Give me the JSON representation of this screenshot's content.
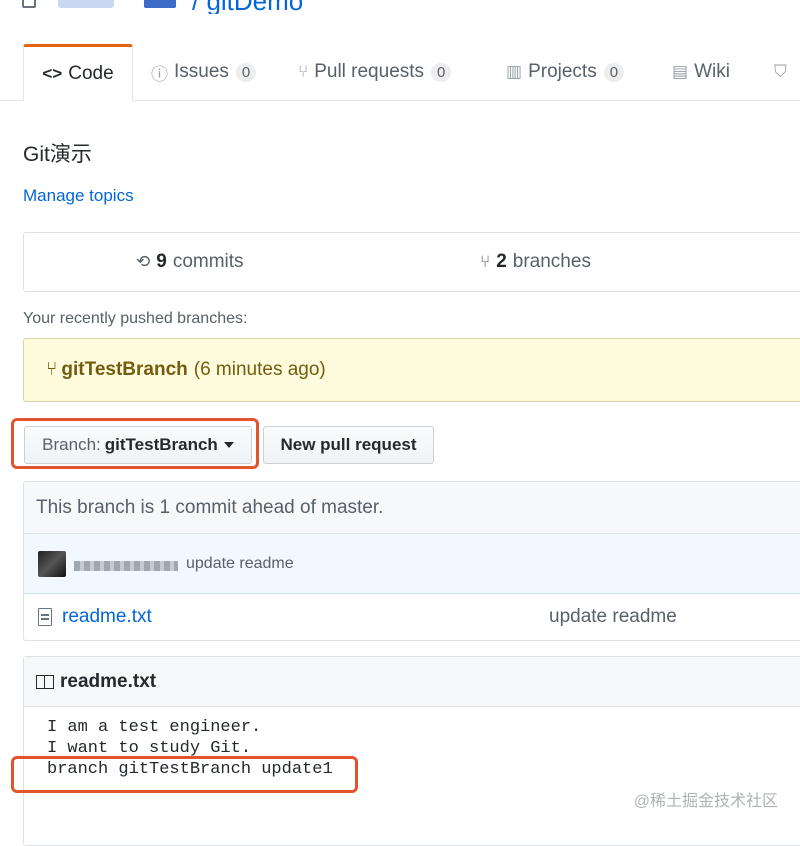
{
  "repo": {
    "name": "/ gitDemo"
  },
  "tabs": [
    {
      "label": "Code",
      "icon": "code-icon"
    },
    {
      "label": "Issues",
      "count": "0",
      "icon": "issue-icon"
    },
    {
      "label": "Pull requests",
      "count": "0",
      "icon": "pull-request-icon"
    },
    {
      "label": "Projects",
      "count": "0",
      "icon": "project-icon"
    },
    {
      "label": "Wiki",
      "icon": "book-icon"
    }
  ],
  "description": "Git演示",
  "manage_topics": "Manage topics",
  "summary": {
    "commits_count": "9",
    "commits_label": "commits",
    "branches_count": "2",
    "branches_label": "branches"
  },
  "recent": {
    "label": "Your recently pushed branches:",
    "branch": "gitTestBranch",
    "time": "(6 minutes ago)"
  },
  "branch_select": {
    "prefix": "Branch:",
    "value": "gitTestBranch"
  },
  "new_pr_label": "New pull request",
  "commit_tease": {
    "ahead_text": "This branch is 1 commit ahead of master.",
    "latest_message": "update readme"
  },
  "files": [
    {
      "name": "readme.txt",
      "message": "update readme"
    }
  ],
  "readme": {
    "title": "readme.txt",
    "lines": [
      "I am a test engineer.",
      "I want to study Git.",
      "branch gitTestBranch update1"
    ]
  },
  "watermark": "@稀土掘金技术社区",
  "colors": {
    "tab_accent": "#e36209",
    "link": "#0366d6",
    "highlight_outline": "#e2542e",
    "recent_bg": "#fffbdd"
  }
}
